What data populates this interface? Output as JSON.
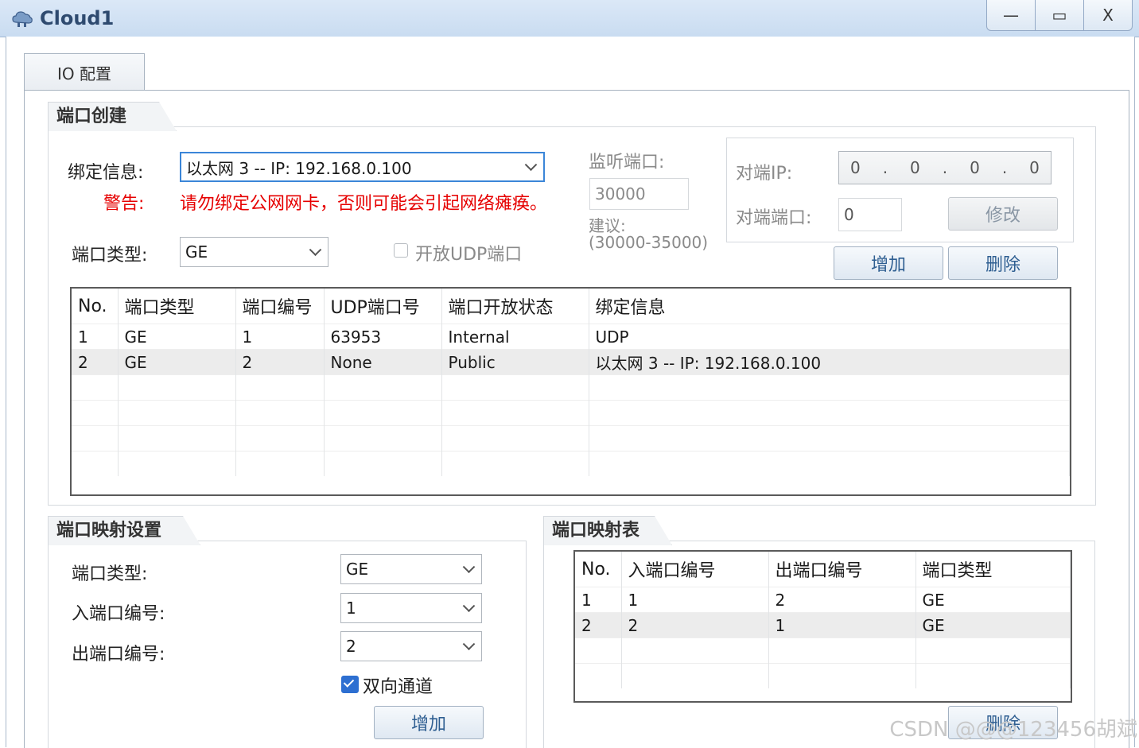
{
  "window": {
    "title": "Cloud1",
    "btn_min": "—",
    "btn_max": "▭",
    "btn_close": "X"
  },
  "tabs": [
    {
      "label": "IO 配置"
    }
  ],
  "port_create": {
    "legend": "端口创建",
    "bind_label": "绑定信息:",
    "bind_value": "以太网 3 -- IP: 192.168.0.100",
    "warn_label": "警告:",
    "warn_text": "请勿绑定公网网卡，否则可能会引起网络瘫痪。",
    "type_label": "端口类型:",
    "type_value": "GE",
    "open_udp_label": "开放UDP端口",
    "open_udp_checked": false,
    "listen_label": "监听端口:",
    "listen_value": "30000",
    "suggest_label": "建议:",
    "suggest_range": "(30000-35000)",
    "peer_ip_label": "对端IP:",
    "peer_ip": [
      "0",
      "0",
      "0",
      "0"
    ],
    "peer_port_label": "对端端口:",
    "peer_port_value": "0",
    "modify_btn": "修改",
    "add_btn": "增加",
    "delete_btn": "删除",
    "table": {
      "headers": [
        "No.",
        "端口类型",
        "端口编号",
        "UDP端口号",
        "端口开放状态",
        "绑定信息"
      ],
      "rows": [
        [
          "1",
          "GE",
          "1",
          "63953",
          "Internal",
          "UDP"
        ],
        [
          "2",
          "GE",
          "2",
          "None",
          "Public",
          "以太网 3 -- IP: 192.168.0.100"
        ]
      ],
      "selected_row": 2
    }
  },
  "port_map_settings": {
    "legend": "端口映射设置",
    "type_label": "端口类型:",
    "type_value": "GE",
    "in_label": "入端口编号:",
    "in_value": "1",
    "out_label": "出端口编号:",
    "out_value": "2",
    "bidirectional_label": "双向通道",
    "bidirectional_checked": true,
    "add_btn": "增加"
  },
  "port_map_table": {
    "legend": "端口映射表",
    "headers": [
      "No.",
      "入端口编号",
      "出端口编号",
      "端口类型"
    ],
    "rows": [
      [
        "1",
        "1",
        "2",
        "GE"
      ],
      [
        "2",
        "2",
        "1",
        "GE"
      ]
    ],
    "selected_row": 2,
    "delete_btn": "删除"
  },
  "watermark": "CSDN @@@123456胡斌",
  "colors": {
    "warning": "#e60000",
    "accent": "#2d6fd1",
    "title": "#2e4a6f"
  }
}
